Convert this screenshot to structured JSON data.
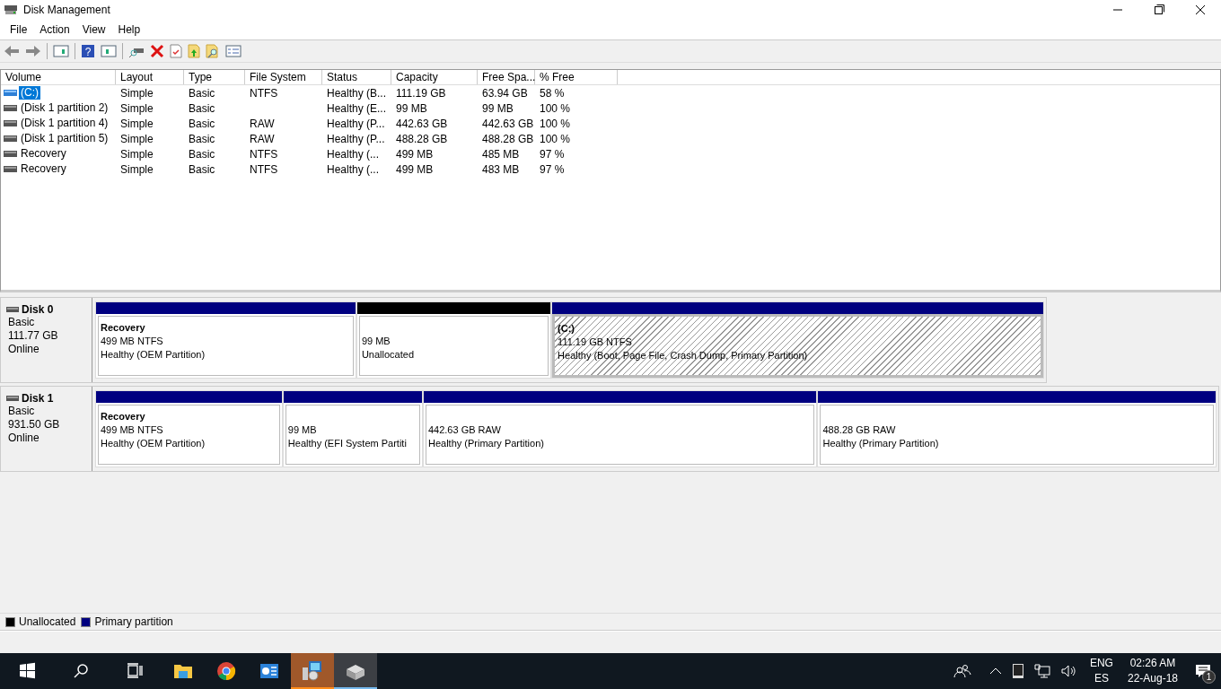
{
  "window": {
    "title": "Disk Management"
  },
  "menu": [
    "File",
    "Action",
    "View",
    "Help"
  ],
  "toolbar": {
    "help_glyph": "?"
  },
  "table": {
    "columns": [
      "Volume",
      "Layout",
      "Type",
      "File System",
      "Status",
      "Capacity",
      "Free Spa...",
      "% Free"
    ],
    "rows": [
      {
        "selected": true,
        "cells": [
          "(C:)",
          "Simple",
          "Basic",
          "NTFS",
          "Healthy (B...",
          "111.19 GB",
          "63.94 GB",
          "58 %"
        ]
      },
      {
        "selected": false,
        "cells": [
          "(Disk 1 partition 2)",
          "Simple",
          "Basic",
          "",
          "Healthy (E...",
          "99 MB",
          "99 MB",
          "100 %"
        ]
      },
      {
        "selected": false,
        "cells": [
          "(Disk 1 partition 4)",
          "Simple",
          "Basic",
          "RAW",
          "Healthy (P...",
          "442.63 GB",
          "442.63 GB",
          "100 %"
        ]
      },
      {
        "selected": false,
        "cells": [
          "(Disk 1 partition 5)",
          "Simple",
          "Basic",
          "RAW",
          "Healthy (P...",
          "488.28 GB",
          "488.28 GB",
          "100 %"
        ]
      },
      {
        "selected": false,
        "cells": [
          "Recovery",
          "Simple",
          "Basic",
          "NTFS",
          "Healthy (...",
          "499 MB",
          "485 MB",
          "97 %"
        ]
      },
      {
        "selected": false,
        "cells": [
          "Recovery",
          "Simple",
          "Basic",
          "NTFS",
          "Healthy (...",
          "499 MB",
          "483 MB",
          "97 %"
        ]
      }
    ]
  },
  "disks": [
    {
      "name": "Disk 0",
      "type": "Basic",
      "size": "111.77 GB",
      "status": "Online",
      "partitions": [
        {
          "kind": "primary",
          "selected": false,
          "label": "Recovery",
          "size": "499 MB NTFS",
          "status": "Healthy (OEM Partition)"
        },
        {
          "kind": "unallocated",
          "selected": false,
          "size": "99 MB",
          "status": "Unallocated"
        },
        {
          "kind": "primary",
          "selected": true,
          "label": "(C:)",
          "size": "111.19 GB NTFS",
          "status": "Healthy (Boot, Page File, Crash Dump, Primary Partition)"
        }
      ]
    },
    {
      "name": "Disk 1",
      "type": "Basic",
      "size": "931.50 GB",
      "status": "Online",
      "partitions": [
        {
          "kind": "primary",
          "selected": false,
          "label": "Recovery",
          "size": "499 MB NTFS",
          "status": "Healthy (OEM Partition)"
        },
        {
          "kind": "primary",
          "selected": false,
          "size": "99 MB",
          "status": "Healthy (EFI System Partiti"
        },
        {
          "kind": "primary",
          "selected": false,
          "size": "442.63 GB RAW",
          "status": "Healthy (Primary Partition)"
        },
        {
          "kind": "primary",
          "selected": false,
          "size": "488.28 GB RAW",
          "status": "Healthy (Primary Partition)"
        }
      ]
    }
  ],
  "legend": [
    {
      "label": "Unallocated",
      "color": "#000000"
    },
    {
      "label": "Primary partition",
      "color": "#000080"
    }
  ],
  "taskbar": {
    "apps": [
      {
        "kind": "explorer",
        "selected": false,
        "flashing": false
      },
      {
        "kind": "browser",
        "selected": false,
        "flashing": false
      },
      {
        "kind": "panel",
        "selected": false,
        "flashing": false
      },
      {
        "kind": "installer",
        "selected": false,
        "flashing": true
      },
      {
        "kind": "disk",
        "selected": true,
        "flashing": false
      }
    ],
    "language": "ENG",
    "layout": "ES",
    "time": "02:26 AM",
    "date": "22-Aug-18",
    "notifications": "1"
  }
}
